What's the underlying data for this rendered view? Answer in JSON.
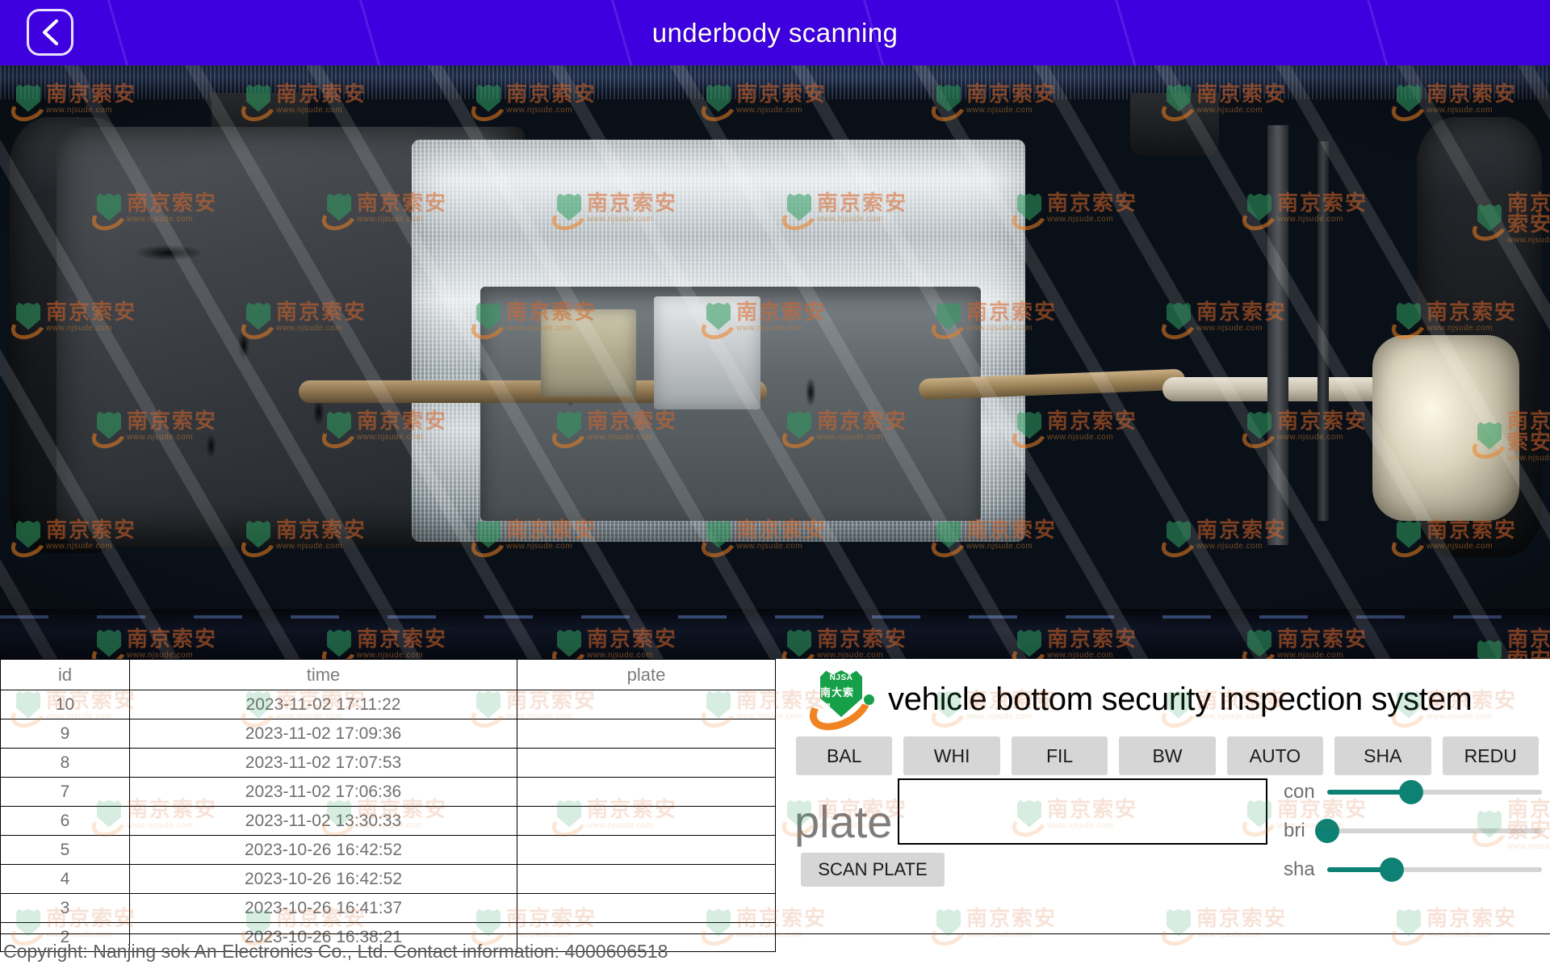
{
  "header": {
    "title": "underbody scanning",
    "back_icon": "chevron-left-icon",
    "background_color": "#3F00DF"
  },
  "scan_view": {
    "watermark_cn": "南京索安",
    "watermark_url": "www.njsude.com",
    "alt": "underbody vehicle scan image"
  },
  "table": {
    "columns": [
      "id",
      "time",
      "plate"
    ],
    "rows": [
      {
        "id": "10",
        "time": "2023-11-02 17:11:22",
        "plate": ""
      },
      {
        "id": "9",
        "time": "2023-11-02 17:09:36",
        "plate": ""
      },
      {
        "id": "8",
        "time": "2023-11-02 17:07:53",
        "plate": ""
      },
      {
        "id": "7",
        "time": "2023-11-02 17:06:36",
        "plate": ""
      },
      {
        "id": "6",
        "time": "2023-11-02 13:30:33",
        "plate": ""
      },
      {
        "id": "5",
        "time": "2023-10-26 16:42:52",
        "plate": ""
      },
      {
        "id": "4",
        "time": "2023-10-26 16:42:52",
        "plate": ""
      },
      {
        "id": "3",
        "time": "2023-10-26 16:41:37",
        "plate": ""
      },
      {
        "id": "2",
        "time": "2023-10-26 16:38:21",
        "plate": ""
      }
    ]
  },
  "footer": {
    "copyright": "Copyright: Nanjing sok An Electronics Co., Ltd. Contact information: 4000606518"
  },
  "panel": {
    "brand": {
      "title": "vehicle bottom security inspection system",
      "logo_line1": "NJSA",
      "logo_line2": "南大索安",
      "logo_green": "#17a04a",
      "logo_orange": "#f08421"
    },
    "filter_buttons": [
      {
        "label": "BAL"
      },
      {
        "label": "WHI"
      },
      {
        "label": "FIL"
      },
      {
        "label": "BW"
      },
      {
        "label": "AUTO"
      },
      {
        "label": "SHA"
      },
      {
        "label": "REDU"
      }
    ],
    "plate": {
      "label": "plate",
      "value": "",
      "placeholder": "",
      "scan_button": "SCAN PLATE"
    },
    "sliders": [
      {
        "name": "con",
        "label": "con",
        "value": 39,
        "accent": "#0d8174"
      },
      {
        "name": "bri",
        "label": "bri",
        "value": 0,
        "accent": "#0d8174"
      },
      {
        "name": "sha",
        "label": "sha",
        "value": 30,
        "accent": "#0d8174"
      }
    ]
  }
}
